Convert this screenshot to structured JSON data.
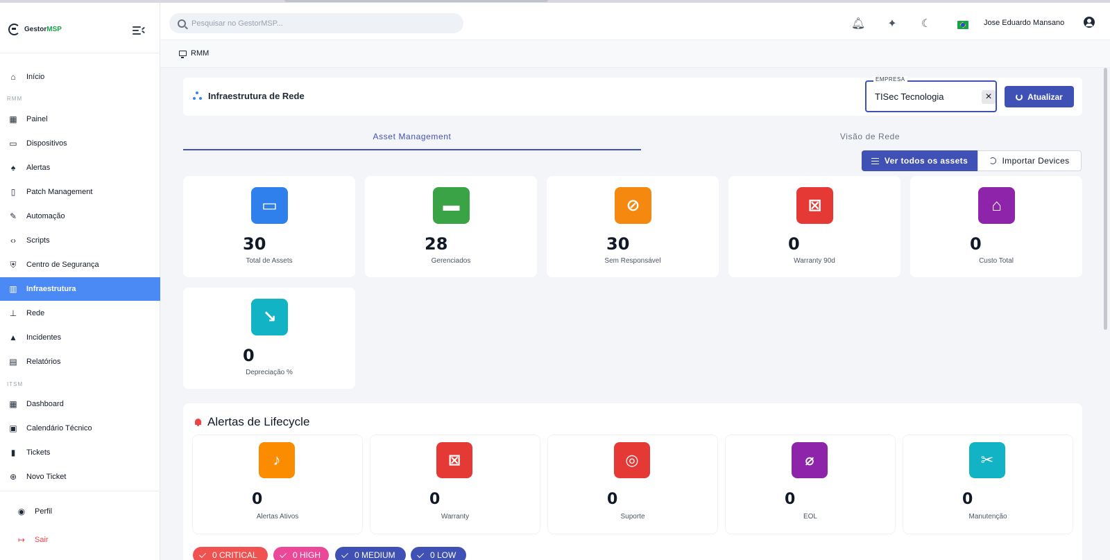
{
  "app": {
    "brand_prefix": "Gestor",
    "brand_suffix": "MSP"
  },
  "sidebar": {
    "sections": {
      "rmm": "RMM",
      "itsm": "ITSM"
    },
    "items": [
      {
        "label": "Início",
        "icon": "home-icon"
      },
      {
        "label": "Painel",
        "icon": "dashboard-icon"
      },
      {
        "label": "Dispositivos",
        "icon": "devices-icon"
      },
      {
        "label": "Alertas",
        "icon": "alarm-icon"
      },
      {
        "label": "Patch Management",
        "icon": "system-update-icon"
      },
      {
        "label": "Automação",
        "icon": "magic-wand-icon"
      },
      {
        "label": "Scripts",
        "icon": "code-icon"
      },
      {
        "label": "Centro de Segurança",
        "icon": "shield-icon"
      },
      {
        "label": "Infraestrutura",
        "icon": "building-icon",
        "active": true
      },
      {
        "label": "Rede",
        "icon": "router-icon"
      },
      {
        "label": "Incidentes",
        "icon": "warning-icon"
      },
      {
        "label": "Relatórios",
        "icon": "bar-chart-icon"
      },
      {
        "label": "Dashboard",
        "icon": "dashboard-icon"
      },
      {
        "label": "Calendário Técnico",
        "icon": "calendar-icon"
      },
      {
        "label": "Tickets",
        "icon": "ticket-icon"
      },
      {
        "label": "Novo Ticket",
        "icon": "add-circle-icon"
      }
    ],
    "profile_label": "Perfil",
    "logout_label": "Sair"
  },
  "topbar": {
    "search_placeholder": "Pesquisar no GestorMSP...",
    "username": "Jose Eduardo Mansano"
  },
  "breadcrumb": {
    "label": "RMM"
  },
  "header": {
    "title": "Infraestrutura de Rede",
    "company_label": "EMPRESA",
    "company_value": "TISec Tecnologia",
    "refresh_label": "Atualizar"
  },
  "tabs": [
    {
      "label": "Asset Management",
      "active": true
    },
    {
      "label": "Visão de Rede",
      "active": false
    }
  ],
  "actions": {
    "view_all_label": "Ver todos os assets",
    "import_label": "Importar Devices"
  },
  "stats": [
    {
      "value": "30",
      "label": "Total de Assets",
      "color": "#2f80ed",
      "icon": "devices-icon"
    },
    {
      "value": "28",
      "label": "Gerenciados",
      "color": "#3aa346",
      "icon": "monitor-icon"
    },
    {
      "value": "30",
      "label": "Sem Responsável",
      "color": "#f5890f",
      "icon": "person-off-icon"
    },
    {
      "value": "0",
      "label": "Warranty 90d",
      "color": "#e53935",
      "icon": "event-busy-icon"
    },
    {
      "value": "0",
      "label": "Custo Total",
      "color": "#8e24aa",
      "icon": "bank-icon"
    },
    {
      "value": "0",
      "label": "Depreciação %",
      "color": "#11b3c4",
      "icon": "trending-down-icon"
    }
  ],
  "lifecycle": {
    "title": "Alertas de Lifecycle",
    "items": [
      {
        "value": "0",
        "label": "Alertas Ativos",
        "color": "#fb8c00",
        "icon": "bell-icon"
      },
      {
        "value": "0",
        "label": "Warranty",
        "color": "#e53935",
        "icon": "event-busy-icon"
      },
      {
        "value": "0",
        "label": "Suporte",
        "color": "#e53935",
        "icon": "support-icon"
      },
      {
        "value": "0",
        "label": "EOL",
        "color": "#8e24aa",
        "icon": "timer-off-icon"
      },
      {
        "value": "0",
        "label": "Manutenção",
        "color": "#11b3c4",
        "icon": "wrench-icon"
      }
    ],
    "chips": [
      {
        "label": "0 CRITICAL",
        "color": "#f05252"
      },
      {
        "label": "0 HIGH",
        "color": "#ec4899"
      },
      {
        "label": "0 MEDIUM",
        "color": "#3f51b5"
      },
      {
        "label": "0 LOW",
        "color": "#3f51b5"
      }
    ]
  }
}
